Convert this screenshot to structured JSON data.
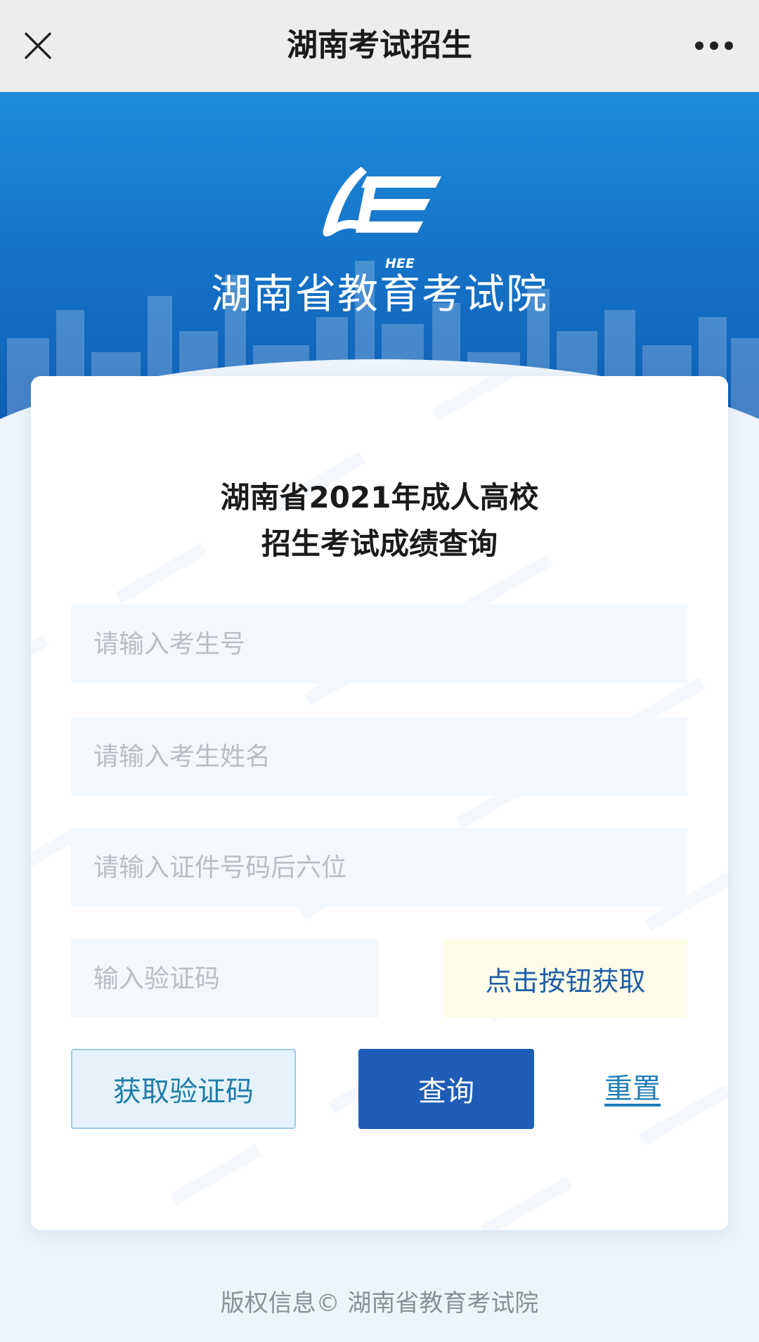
{
  "appbar": {
    "title": "湖南考试招生",
    "close_icon": "close-icon",
    "more_icon": "more-dots-icon"
  },
  "hero": {
    "org_name": "湖南省教育考试院",
    "logo_text": "HEE"
  },
  "form": {
    "heading_line1": "湖南省2021年成人高校",
    "heading_line2": "招生考试成绩查询",
    "exam_number": {
      "value": "",
      "placeholder": "请输入考生号"
    },
    "name": {
      "value": "",
      "placeholder": "请输入考生姓名"
    },
    "id_last6": {
      "value": "",
      "placeholder": "请输入证件号码后六位"
    },
    "captcha": {
      "value": "",
      "placeholder": "输入验证码"
    },
    "captcha_box_label": "点击按钮获取",
    "get_code_label": "获取验证码",
    "query_label": "查询",
    "reset_label": "重置"
  },
  "footer": {
    "copyright": "版权信息© 湖南省教育考试院"
  },
  "colors": {
    "hero_top": "#1f8cdc",
    "hero_bottom": "#0f5bb2",
    "query_button": "#1f5cb8",
    "link": "#1e7db8",
    "captcha_bg": "#fdfdea"
  }
}
